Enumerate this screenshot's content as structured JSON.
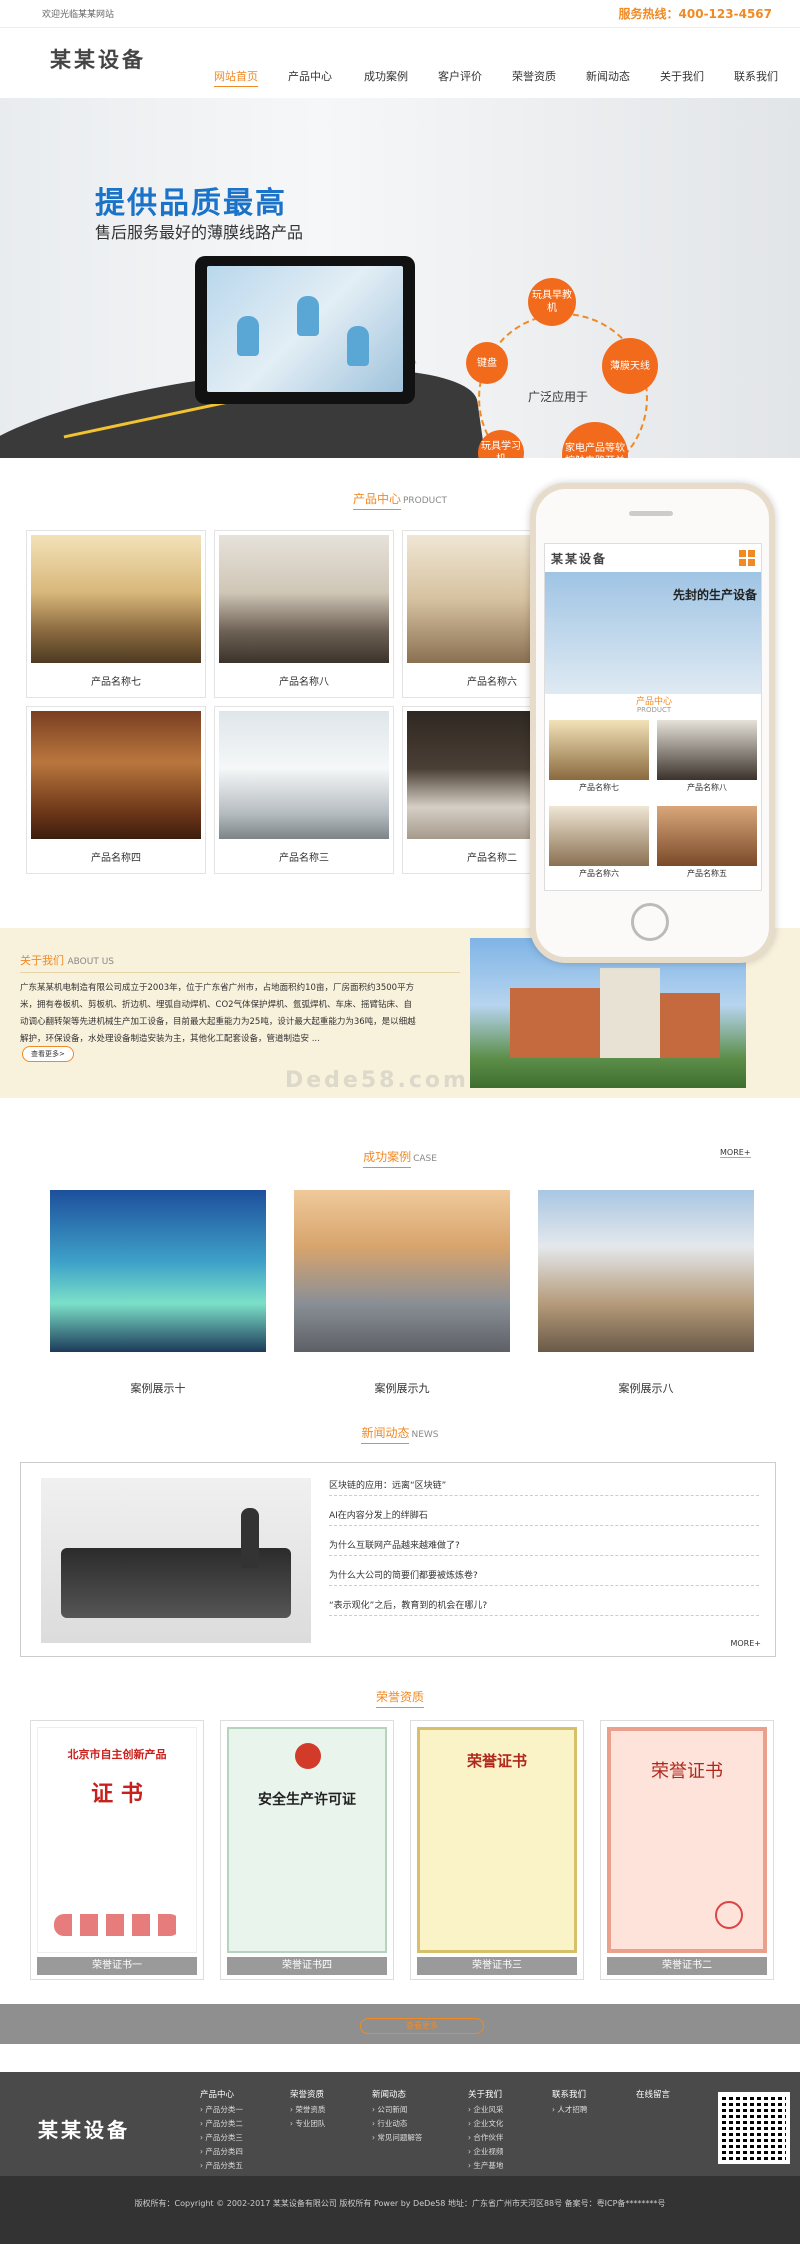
{
  "topbar": {
    "welcome": "欢迎光临某某网站",
    "hotline": "服务热线：400-123-4567"
  },
  "header": {
    "logo": "某某设备",
    "nav": [
      "网站首页",
      "产品中心",
      "成功案例",
      "客户评价",
      "荣誉资质",
      "新闻动态",
      "关于我们",
      "联系我们"
    ]
  },
  "banner": {
    "title": "提供品质最高",
    "subtitle": "售后服务最好的薄膜线路产品",
    "center_label": "广泛应用于",
    "bubbles": [
      "玩具早教机",
      "薄膜天线",
      "家电产品等软按触电路开关",
      "玩具学习机",
      "键盘"
    ]
  },
  "products": {
    "title_cn": "产品中心",
    "title_en": "PRODUCT",
    "items": [
      "产品名称七",
      "产品名称八",
      "产品名称六",
      "产品名称四",
      "产品名称三",
      "产品名称二"
    ]
  },
  "phone": {
    "logo": "某某设备",
    "banner_text": "先封的生产设备",
    "title_cn": "产品中心",
    "title_en": "PRODUCT",
    "items": [
      "产品名称七",
      "产品名称八",
      "产品名称六",
      "产品名称五"
    ]
  },
  "about": {
    "title_cn": "关于我们",
    "title_en": "ABOUT US",
    "text": "广东某某机电制造有限公司成立于2003年，位于广东省广州市，占地面积约10亩，厂房面积约3500平方米，拥有卷板机、剪板机、折边机、埋弧自动焊机、CO2气体保护焊机、氩弧焊机、车床、摇臂钻床、自动调心翻转架等先进机械生产加工设备，目前最大起重能力为25吨，设计最大起重能力为36吨，是以细越解护，环保设备，水处理设备制造安装为主，其他化工配套设备，管道制造安 ...",
    "more": "查看更多>"
  },
  "watermark": "Dede58.com",
  "cases": {
    "title_cn": "成功案例",
    "title_en": "CASE",
    "more": "MORE+",
    "items": [
      "案例展示十",
      "案例展示九",
      "案例展示八"
    ]
  },
  "news": {
    "title_cn": "新闻动态",
    "title_en": "NEWS",
    "more": "MORE+",
    "items": [
      "区块链的应用：远离“区块链”",
      "AI在内容分发上的绊脚石",
      "为什么互联网产品越来越难做了?",
      "为什么大公司的简要们都要被炼炼卷?",
      "“表示观化”之后，教育到的机会在哪儿?"
    ]
  },
  "honors": {
    "title_cn": "荣誉资质",
    "items": [
      "荣誉证书一",
      "荣誉证书四",
      "荣誉证书三",
      "荣誉证书二"
    ],
    "cert_texts": [
      "北京市自主创新产品",
      "证 书",
      "安全生产许可证",
      "荣誉证书",
      "荣誉证书"
    ],
    "more": "查看更多"
  },
  "footer": {
    "logo": "某某设备",
    "columns": [
      {
        "title": "产品中心",
        "links": [
          "产品分类一",
          "产品分类二",
          "产品分类三",
          "产品分类四",
          "产品分类五"
        ]
      },
      {
        "title": "荣誉资质",
        "links": [
          "荣誉资质",
          "专业团队"
        ]
      },
      {
        "title": "新闻动态",
        "links": [
          "公司新闻",
          "行业动态",
          "常见问题解答"
        ]
      },
      {
        "title": "关于我们",
        "links": [
          "企业风采",
          "企业文化",
          "合作伙伴",
          "企业视频",
          "生产基地"
        ]
      },
      {
        "title": "联系我们",
        "links": [
          "人才招聘"
        ]
      },
      {
        "title": "在线留言",
        "links": []
      }
    ],
    "copyright": "版权所有：Copyright © 2002-2017 某某设备有限公司 版权所有 Power by DeDe58 地址：广东省广州市天河区88号 备案号：粤ICP备********号"
  },
  "colors": {
    "accent": "#f08a24",
    "bubble": "#f26b1d",
    "about_bg": "#f8f1dc",
    "footer_bg": "#4a4a4a"
  }
}
